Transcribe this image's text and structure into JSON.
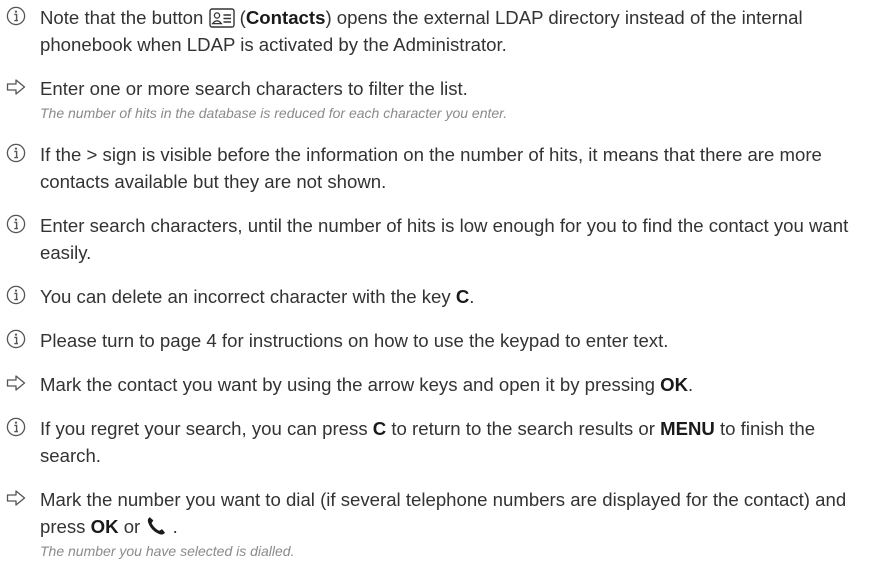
{
  "items": [
    {
      "type": "info",
      "parts": [
        "Note that the button ",
        "(",
        "Contacts",
        ") opens the external LDAP directory instead of the internal phonebook when LDAP is activated by the Administrator."
      ],
      "icon": "contacts-button-icon"
    },
    {
      "type": "step",
      "text": "Enter one or more search characters to filter the list.",
      "note": "The number of hits in the database is reduced for each character you enter."
    },
    {
      "type": "info",
      "text": "If the > sign is visible before the information on the number of hits, it means that there are more contacts available but they are not shown."
    },
    {
      "type": "info",
      "text": "Enter search characters, until the number of hits is low enough for you to find the contact you want easily."
    },
    {
      "type": "info",
      "parts": [
        "You can delete an incorrect character with the key ",
        "C",
        "."
      ]
    },
    {
      "type": "info",
      "text": "Please turn to page 4 for instructions on how to use the keypad to enter text."
    },
    {
      "type": "step",
      "parts": [
        "Mark the contact you want by using the arrow keys and open it by pressing ",
        "OK",
        "."
      ]
    },
    {
      "type": "info",
      "parts": [
        "If you regret your search, you can press ",
        "C",
        " to return to the search results or ",
        "MENU",
        " to finish the search."
      ]
    },
    {
      "type": "step",
      "parts": [
        "Mark the number you want to dial (if several telephone numbers are displayed for the contact) and press ",
        "OK",
        " or ",
        " ."
      ],
      "icon": "phone-icon",
      "note": "The number you have selected is dialled."
    }
  ]
}
